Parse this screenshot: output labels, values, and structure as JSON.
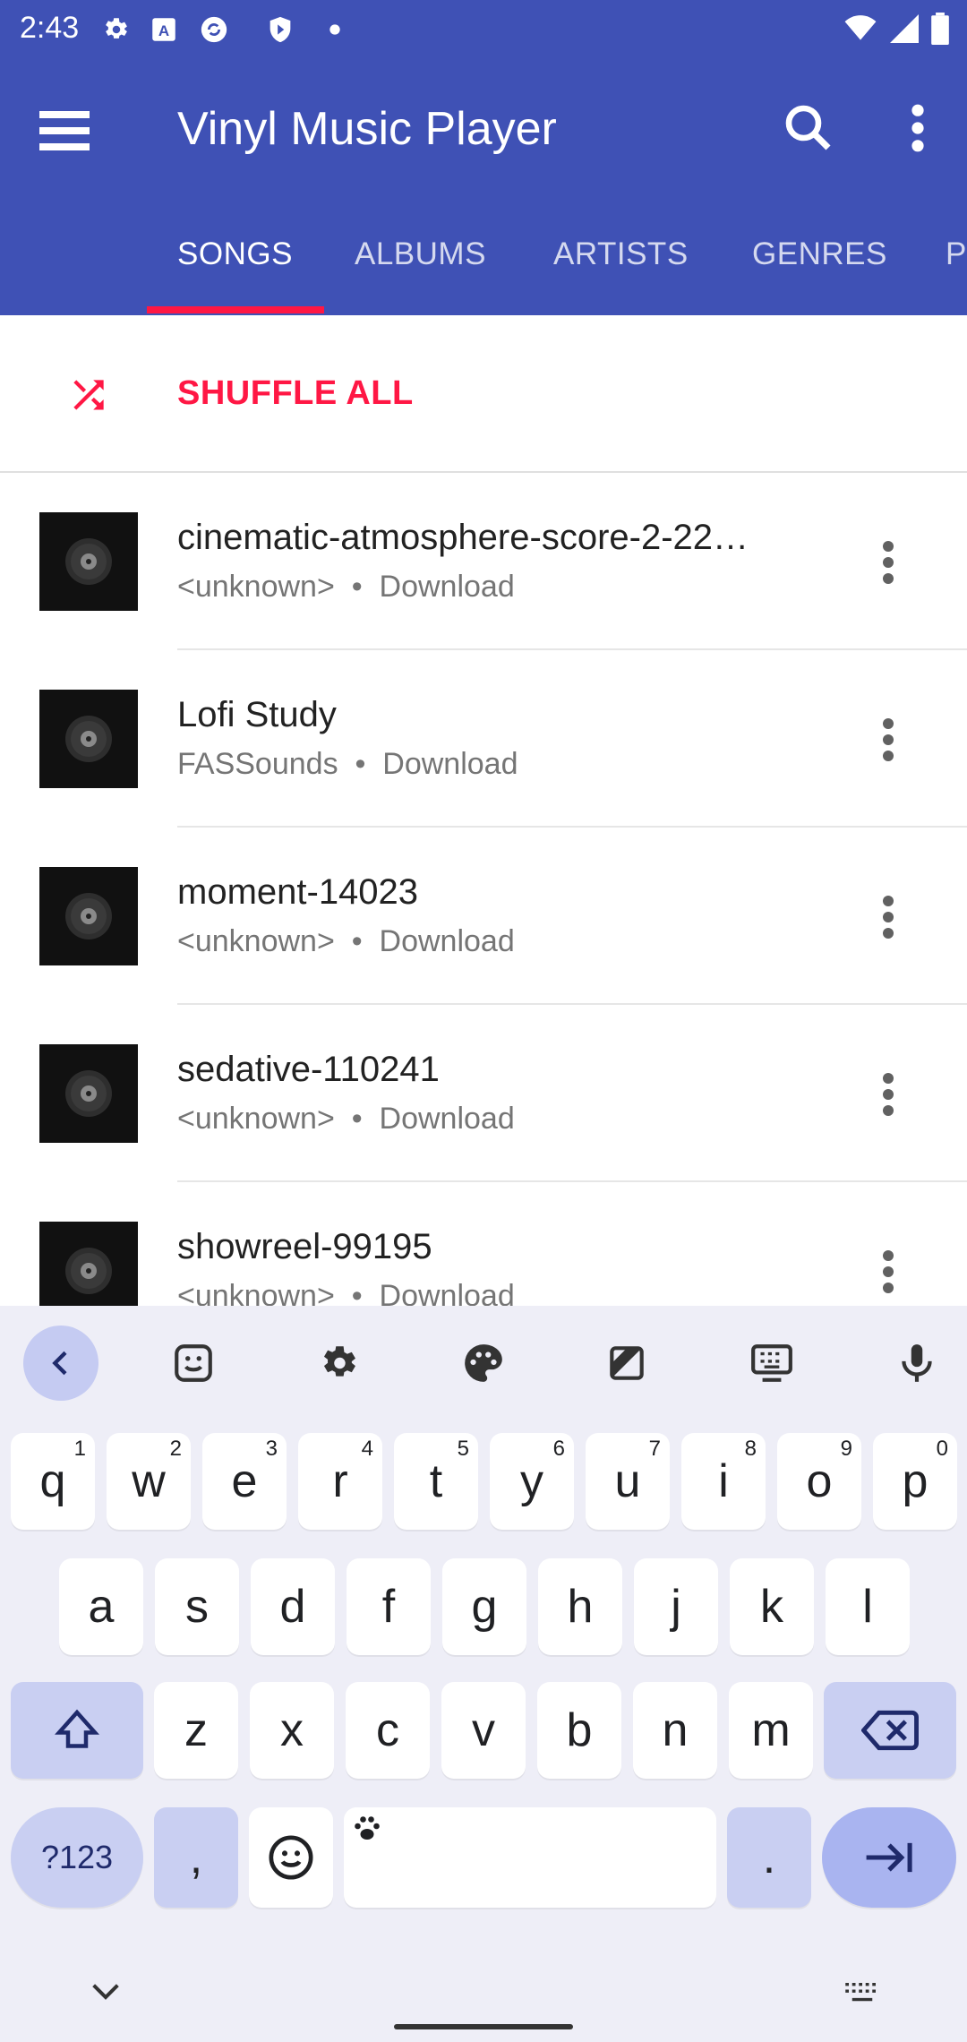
{
  "status_bar": {
    "time": "2:43"
  },
  "app": {
    "title": "Vinyl Music Player",
    "accent": "#ff1744",
    "primary": "#3f51b5"
  },
  "tabs": [
    {
      "label": "SONGS",
      "active": true
    },
    {
      "label": "ALBUMS"
    },
    {
      "label": "ARTISTS"
    },
    {
      "label": "GENRES"
    },
    {
      "label": "P"
    }
  ],
  "shuffle": {
    "label": "SHUFFLE ALL",
    "icon": "shuffle-icon"
  },
  "songs": [
    {
      "title": "cinematic-atmosphere-score-2-22…",
      "artist": "<unknown>",
      "album": "Download"
    },
    {
      "title": "Lofi Study",
      "artist": "FASSounds",
      "album": "Download"
    },
    {
      "title": "moment-14023",
      "artist": "<unknown>",
      "album": "Download"
    },
    {
      "title": "sedative-110241",
      "artist": "<unknown>",
      "album": "Download"
    },
    {
      "title": "showreel-99195",
      "artist": "<unknown>",
      "album": "Download"
    }
  ],
  "separator": "•",
  "keyboard": {
    "row1": [
      {
        "k": "q",
        "h": "1"
      },
      {
        "k": "w",
        "h": "2"
      },
      {
        "k": "e",
        "h": "3"
      },
      {
        "k": "r",
        "h": "4"
      },
      {
        "k": "t",
        "h": "5"
      },
      {
        "k": "y",
        "h": "6"
      },
      {
        "k": "u",
        "h": "7"
      },
      {
        "k": "i",
        "h": "8"
      },
      {
        "k": "o",
        "h": "9"
      },
      {
        "k": "p",
        "h": "0"
      }
    ],
    "row2": [
      "a",
      "s",
      "d",
      "f",
      "g",
      "h",
      "j",
      "k",
      "l"
    ],
    "row3": [
      "z",
      "x",
      "c",
      "v",
      "b",
      "n",
      "m"
    ],
    "symbols_label": "?123",
    "comma": ",",
    "period": "."
  }
}
